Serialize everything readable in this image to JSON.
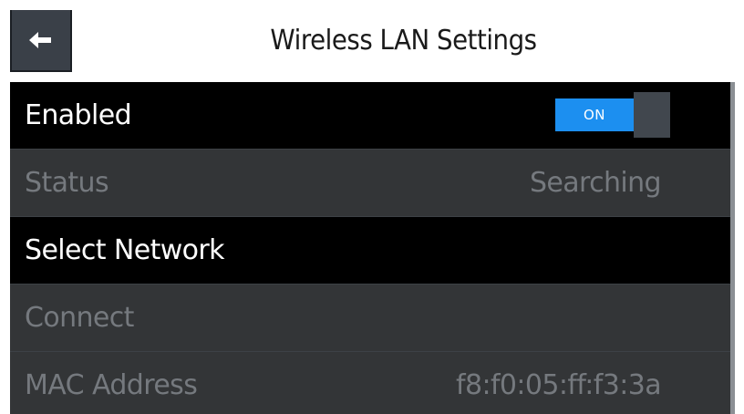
{
  "header": {
    "title": "Wireless LAN Settings",
    "back_icon": "arrow-left-icon"
  },
  "rows": [
    {
      "label": "Enabled",
      "toggle_label": "ON",
      "toggle_state": "on"
    },
    {
      "label": "Status",
      "value": "Searching"
    },
    {
      "label": "Select Network"
    },
    {
      "label": "Connect"
    },
    {
      "label": "MAC Address",
      "value": "f8:f0:05:ff:f3:3a"
    }
  ],
  "colors": {
    "accent": "#1c8ff0",
    "active_row": "#000000",
    "inactive_row": "#333537",
    "inactive_text": "#75797e"
  }
}
